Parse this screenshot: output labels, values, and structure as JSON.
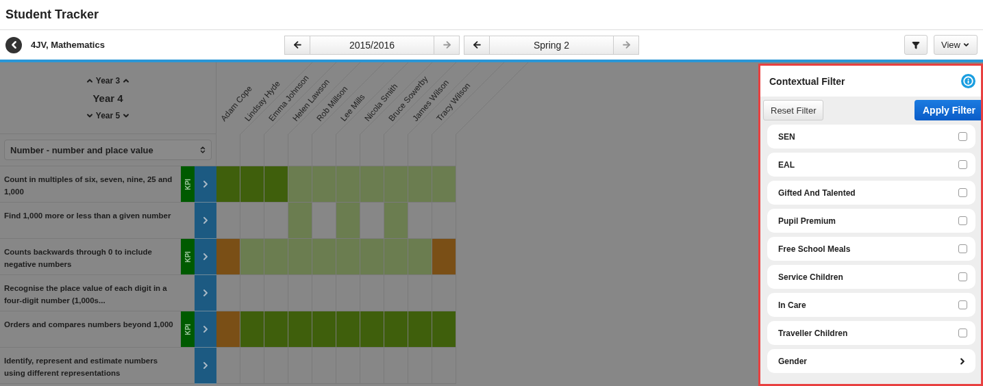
{
  "app_title": "Student Tracker",
  "class_name": "4JV, Mathematics",
  "year_nav": {
    "label": "2015/2016",
    "next_disabled": true
  },
  "term_nav": {
    "label": "Spring 2",
    "next_disabled": true
  },
  "view_button": "View",
  "year_selector": {
    "previous": "Year 3",
    "current": "Year 4",
    "next": "Year 5"
  },
  "strand_select": {
    "value": "Number - number and place value"
  },
  "students": [
    "Adam Cope",
    "Lindsay Hyde",
    "Emma Johnson",
    "Helen Lawson",
    "Rob Millson",
    "Lee Mills",
    "Nicola Smith",
    "Bruce Sowerby",
    "James Wilson",
    "Tracy Wilson"
  ],
  "objectives": [
    {
      "text": "Count in multiples of six, seven, nine, 25 and 1,000",
      "badge": "KPI",
      "cells": [
        {
          "color": "#3f5f0c"
        },
        {
          "color": "#3f5f0c"
        },
        {
          "color": "#3f5f0c"
        },
        {
          "color": "#6b7d50"
        },
        {
          "color": "#6b7d50"
        },
        {
          "color": "#6b7d50"
        },
        {
          "color": "#6b7d50"
        },
        {
          "color": "#6b7d50"
        },
        {
          "color": "#6b7d50"
        },
        {
          "color": "#6b7d50"
        }
      ]
    },
    {
      "text": "Find 1,000 more or less than a given number",
      "cells": [
        {
          "color": "#878787"
        },
        {
          "color": "#878787"
        },
        {
          "color": "#878787"
        },
        {
          "color": "#6b7d50"
        },
        {
          "color": "#878787"
        },
        {
          "color": "#6b7d50"
        },
        {
          "color": "#878787"
        },
        {
          "color": "#6b7d50"
        },
        {
          "color": "#878787"
        },
        {
          "color": "#878787"
        }
      ]
    },
    {
      "text": "Counts backwards through 0 to include negative numbers",
      "badge": "KPI",
      "cells": [
        {
          "color": "#7a4f16"
        },
        {
          "color": "#6b7d50"
        },
        {
          "color": "#6b7d50"
        },
        {
          "color": "#6b7d50"
        },
        {
          "color": "#6b7d50"
        },
        {
          "color": "#6b7d50"
        },
        {
          "color": "#6b7d50"
        },
        {
          "color": "#6b7d50"
        },
        {
          "color": "#6b7d50"
        },
        {
          "color": "#7a4f16"
        }
      ]
    },
    {
      "text": "Recognise the place value of each digit in a four-digit number (1,000s...",
      "cells": [
        {
          "color": "#878787"
        },
        {
          "color": "#878787"
        },
        {
          "color": "#878787"
        },
        {
          "color": "#878787"
        },
        {
          "color": "#878787"
        },
        {
          "color": "#878787"
        },
        {
          "color": "#878787"
        },
        {
          "color": "#878787"
        },
        {
          "color": "#878787"
        },
        {
          "color": "#878787"
        }
      ]
    },
    {
      "text": "Orders and compares numbers beyond 1,000",
      "badge": "KPI",
      "cells": [
        {
          "color": "#7a4f16"
        },
        {
          "color": "#3f5f0c"
        },
        {
          "color": "#3f5f0c"
        },
        {
          "color": "#3f5f0c"
        },
        {
          "color": "#3f5f0c"
        },
        {
          "color": "#3f5f0c"
        },
        {
          "color": "#3f5f0c"
        },
        {
          "color": "#3f5f0c"
        },
        {
          "color": "#3f5f0c"
        },
        {
          "color": "#3f5f0c"
        }
      ]
    },
    {
      "text": "Identify, represent and estimate numbers using different representations",
      "cells": [
        {
          "color": "#878787"
        },
        {
          "color": "#878787"
        },
        {
          "color": "#878787"
        },
        {
          "color": "#878787"
        },
        {
          "color": "#878787"
        },
        {
          "color": "#878787"
        },
        {
          "color": "#878787"
        },
        {
          "color": "#878787"
        },
        {
          "color": "#878787"
        },
        {
          "color": "#878787"
        }
      ]
    }
  ],
  "filter": {
    "title": "Contextual Filter",
    "reset": "Reset Filter",
    "apply": "Apply Filter",
    "options": [
      {
        "label": "SEN",
        "kind": "checkbox",
        "checked": false
      },
      {
        "label": "EAL",
        "kind": "checkbox",
        "checked": false
      },
      {
        "label": "Gifted And Talented",
        "kind": "checkbox",
        "checked": false
      },
      {
        "label": "Pupil Premium",
        "kind": "checkbox",
        "checked": false
      },
      {
        "label": "Free School Meals",
        "kind": "checkbox",
        "checked": false
      },
      {
        "label": "Service Children",
        "kind": "checkbox",
        "checked": false
      },
      {
        "label": "In Care",
        "kind": "checkbox",
        "checked": false
      },
      {
        "label": "Traveller Children",
        "kind": "checkbox",
        "checked": false
      },
      {
        "label": "Gender",
        "kind": "submenu"
      }
    ]
  }
}
